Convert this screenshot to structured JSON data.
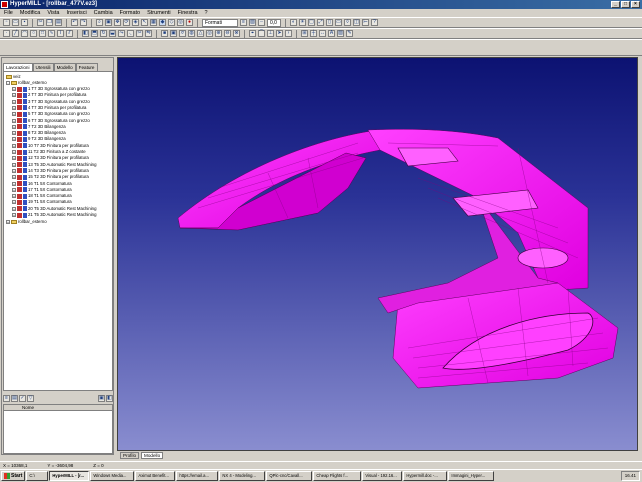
{
  "window": {
    "title": "HyperMILL - [rollbar_477V.ez3]"
  },
  "menu": [
    "File",
    "Modifica",
    "Vista",
    "Inserisci",
    "Cambia",
    "Formato",
    "Strumenti",
    "Finestra",
    "?"
  ],
  "toolbar": {
    "format_label": "Formati",
    "zoom_value": "0,0"
  },
  "panel_tabs": [
    "Lavorazioni",
    "Utensili",
    "Modello",
    "Feature"
  ],
  "tree": {
    "root": "rollbar_esterno",
    "top_item": "veiz",
    "jobs": [
      "1 T7 3D Sgrossatura con grezzo",
      "2 T7 3D Finitura per profilatura",
      "3 T7 3D Sgrossatura con grezzo",
      "4 T7 3D Finitura per profilatura",
      "5 T7 3D Sgrossatura con grezzo",
      "6 T7 3D Sgrossatura con grezzo",
      "7 T2 3D Bilangenza",
      "8 T2 3D Bilangenza",
      "9 T2 3D Bilangenza",
      "10 T7 3D Finitura per profilatura",
      "11 T2 3D Finitura a Z costante",
      "12 T3 3D Finitura per profilatura",
      "13 T5 3D Automatic Rest Machining",
      "14 T3 3D Finitura per profilatura",
      "15 T2 3D Finitura per profilatura",
      "16 T1 5X Contornatura",
      "17 T1 5X Contornatura",
      "18 T1 5X Contornatura",
      "19 T1 5X Contornatura",
      "20 T5 3D Automatic Rest Machining",
      "21 T5 3D Automatic Rest Machining"
    ],
    "bottom_item": "rollbar_esterno"
  },
  "prop_header": "Nome",
  "view_tabs": [
    "Profilo",
    "Modello"
  ],
  "status": {
    "x": "X = 10368,1",
    "y": "Y = -3604,98",
    "z": "Z = 0"
  },
  "taskbar": {
    "start": "Start",
    "items": [
      "C:\\",
      "HyperMILL - [r...",
      "Windows Media...",
      "Aximut Benefit...",
      "https://email.a...",
      "NX 4 - Modeling...",
      "QPlc-cnc/Cavall...",
      "Cheap Flights f...",
      "Visual - 192.16...",
      "Hypermill.doc -...",
      "Immagini_Hyper..."
    ],
    "active_index": 1,
    "clock": "16.41"
  },
  "colors": {
    "part": "#ff00ff",
    "bg_top": "#0c1272",
    "bg_bottom": "#8a8ed0"
  }
}
